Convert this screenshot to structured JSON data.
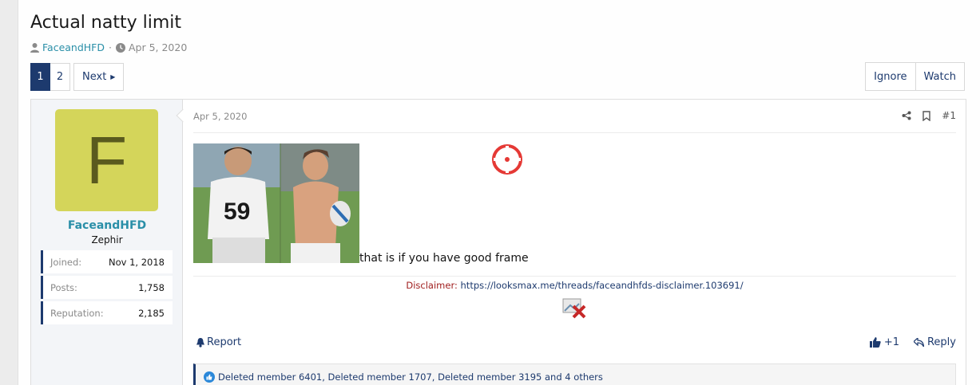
{
  "thread": {
    "title": "Actual natty limit",
    "author": "FaceandHFD",
    "separator": "·",
    "date": "Apr 5, 2020"
  },
  "pagination": {
    "current": "1",
    "page2": "2",
    "next": "Next"
  },
  "actions": {
    "ignore": "Ignore",
    "watch": "Watch"
  },
  "user": {
    "avatar_letter": "F",
    "avatar_color": "#d4d55a",
    "name": "FaceandHFD",
    "title": "Zephir",
    "stats": [
      {
        "label": "Joined:",
        "value": "Nov 1, 2018"
      },
      {
        "label": "Posts:",
        "value": "1,758"
      },
      {
        "label": "Reputation:",
        "value": "2,185"
      }
    ]
  },
  "post": {
    "date": "Apr 5, 2020",
    "number": "#1",
    "text": "that is if you have good frame",
    "share_icon": "share-icon",
    "bookmark_icon": "bookmark-icon",
    "signature": {
      "label": "Disclaimer:",
      "link": "https://looksmax.me/threads/faceandhfds-disclaimer.103691/"
    },
    "report": "Report",
    "like_count": "+1",
    "reply": "Reply",
    "reactions": "Deleted member 6401, Deleted member 1707, Deleted member 3195 and 4 others"
  },
  "colors": {
    "accent": "#1d3a6e",
    "link": "#2a8fa8",
    "disclaimer": "#a01e1e"
  }
}
